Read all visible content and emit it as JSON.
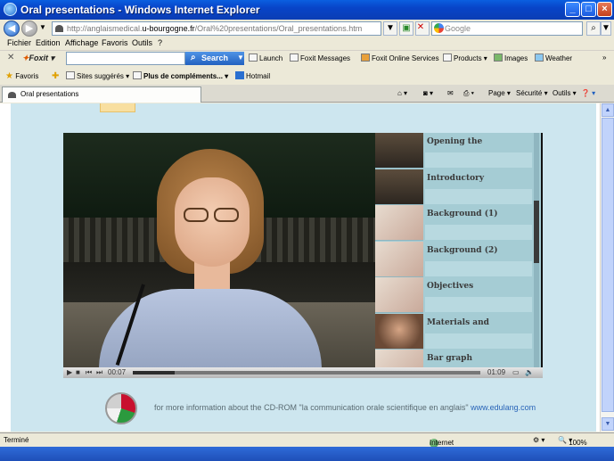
{
  "window": {
    "title": "Oral presentations - Windows Internet Explorer"
  },
  "address": {
    "url_prefix": "http://anglaismedical.",
    "url_domain": "u-bourgogne.fr",
    "url_suffix": "/Oral%20presentations/Oral_presentations.htm",
    "search_placeholder": "Google"
  },
  "menu": [
    "Fichier",
    "Edition",
    "Affichage",
    "Favoris",
    "Outils",
    "?"
  ],
  "foxit": {
    "brand": "Foxit",
    "search_label": "Search",
    "items": [
      "Launch",
      "Foxit Messages",
      "Foxit Online Services",
      "Products",
      "Images",
      "Weather"
    ]
  },
  "favbar": {
    "favoris": "Favoris",
    "sites": "Sites suggérés",
    "plus": "Plus de compléments...",
    "hotmail": "Hotmail"
  },
  "tab": {
    "label": "Oral presentations"
  },
  "commands": {
    "page": "Page",
    "securite": "Sécurité",
    "outils": "Outils"
  },
  "playlist": [
    {
      "title": "Opening the",
      "thumb": "room"
    },
    {
      "title": "Introductory",
      "thumb": "room"
    },
    {
      "title": "Background (1)",
      "thumb": "doc"
    },
    {
      "title": "Background (2)",
      "thumb": "doc"
    },
    {
      "title": "Objectives",
      "thumb": "doc"
    },
    {
      "title": "Materials and",
      "thumb": "face"
    },
    {
      "title": "Bar graph",
      "thumb": "doc"
    }
  ],
  "player": {
    "elapsed": "00:07",
    "duration": "01:09",
    "progress": 0.12
  },
  "footer": {
    "text": "for more information about the CD-ROM \"la communication orale scientifique en anglais\"",
    "link": "www.edulang.com"
  },
  "status": {
    "left": "Terminé",
    "zone": "Internet",
    "zoom": "100%"
  }
}
